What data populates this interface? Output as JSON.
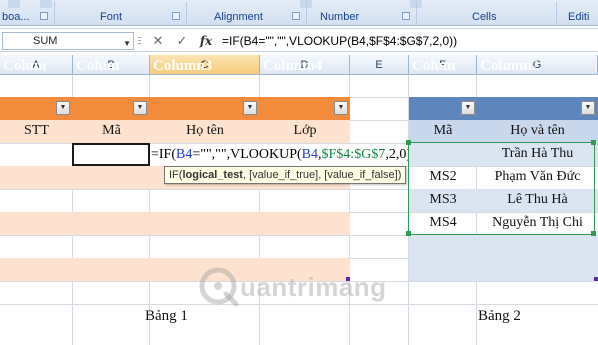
{
  "ribbon": {
    "groups": [
      {
        "label": "boa...",
        "launcher": true
      },
      {
        "label": "Font",
        "launcher": true
      },
      {
        "label": "Alignment",
        "launcher": true
      },
      {
        "label": "Number",
        "launcher": true
      },
      {
        "label": "Cells",
        "launcher": false
      },
      {
        "label": "Editi",
        "launcher": false
      }
    ]
  },
  "formula_bar": {
    "name_box": "SUM",
    "cancel_icon": "✕",
    "enter_icon": "✓",
    "fx_label": "fx",
    "formula": "=IF(B4=\"\",\"\",VLOOKUP(B4,$F$4:$G$7,2,0))"
  },
  "columns": [
    "A",
    "B",
    "C",
    "D",
    "E",
    "F",
    "G"
  ],
  "active_column": "C",
  "table1": {
    "headers": [
      "Colum",
      "Colum",
      "Column3",
      "Column4"
    ],
    "subheaders": [
      "STT",
      "Mã",
      "Họ tên",
      "Lớp"
    ],
    "caption": "Bảng 1"
  },
  "table2": {
    "headers": [
      "Colum",
      "Column2"
    ],
    "subheaders": [
      "Mã",
      "Họ và tên"
    ],
    "rows": [
      {
        "ma": "",
        "name": "Trần Hà Thu"
      },
      {
        "ma": "MS2",
        "name": "Phạm Văn Đức"
      },
      {
        "ma": "MS3",
        "name": "Lê Thu Hà"
      },
      {
        "ma": "MS4",
        "name": "Nguyễn Thị Chi"
      }
    ],
    "caption": "Bảng 2"
  },
  "cell_editor": {
    "p1": "=IF(",
    "ref1": "B4",
    "p2": "=\"\",\"\",VLOOKUP(",
    "ref2": "B4",
    "p3": ",",
    "ref3": "$F$4:$G$7",
    "p4": ",2,0))"
  },
  "tooltip": {
    "fn": "IF(",
    "arg_bold": "logical_test",
    "rest": ", [value_if_true], [value_if_false])"
  },
  "watermark": {
    "text": "uantrimang"
  },
  "colors": {
    "table1_header": "#f28c3c",
    "table1_stripe": "#fde3cf",
    "table2_header": "#5e86bd",
    "table2_stripe": "#dbe5f2",
    "range_border": "#2f9a53"
  }
}
